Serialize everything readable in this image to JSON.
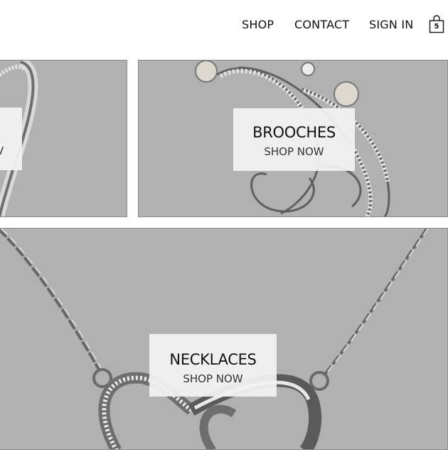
{
  "header": {
    "nav": [
      {
        "label": "SHOP"
      },
      {
        "label": "CONTACT"
      },
      {
        "label": "SIGN IN"
      }
    ],
    "cart": {
      "icon": "shopping-bag-icon",
      "count": "5"
    }
  },
  "categories": {
    "rings": {
      "cta": "V"
    },
    "brooches": {
      "title": "BROOCHES",
      "cta": "SHOP NOW"
    },
    "necklaces": {
      "title": "NECKLACES",
      "cta": "SHOP NOW"
    }
  },
  "colors": {
    "tile_bg": "#b1b1b1",
    "card_bg": "#f2f2f2",
    "text": "#111111"
  }
}
